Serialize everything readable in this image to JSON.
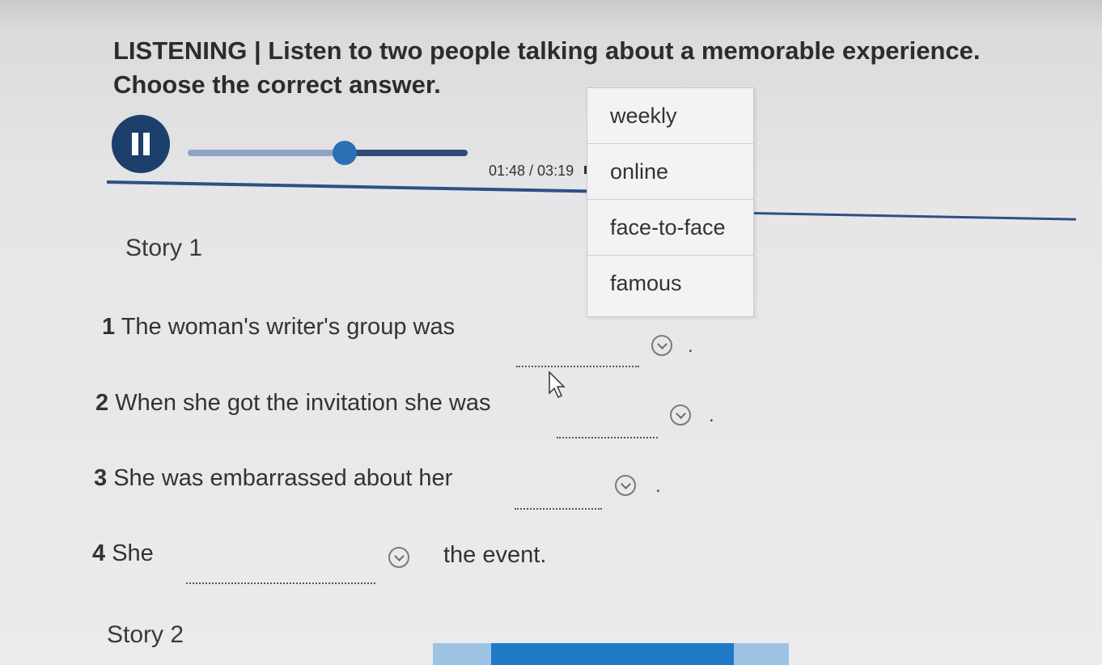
{
  "instructions": "LISTENING | Listen to two people talking about a memorable experience. Choose the correct answer.",
  "audio": {
    "time": "01:48 / 03:19",
    "progress": 0.56,
    "state": "playing"
  },
  "dropdown_options": [
    "weekly",
    "online",
    "face-to-face",
    "famous"
  ],
  "story1": {
    "title": "Story 1",
    "questions": [
      {
        "number": "1",
        "text": "The woman's writer's group was",
        "end": "."
      },
      {
        "number": "2",
        "text": "When she got the invitation she was",
        "end": "."
      },
      {
        "number": "3",
        "text": "She was embarrassed about her",
        "end": "."
      },
      {
        "number": "4",
        "text": "She",
        "after": "the event."
      }
    ]
  },
  "story2": {
    "title": "Story 2"
  },
  "colors": {
    "accent": "#1c3f6b",
    "button": "#1f7ac6"
  }
}
